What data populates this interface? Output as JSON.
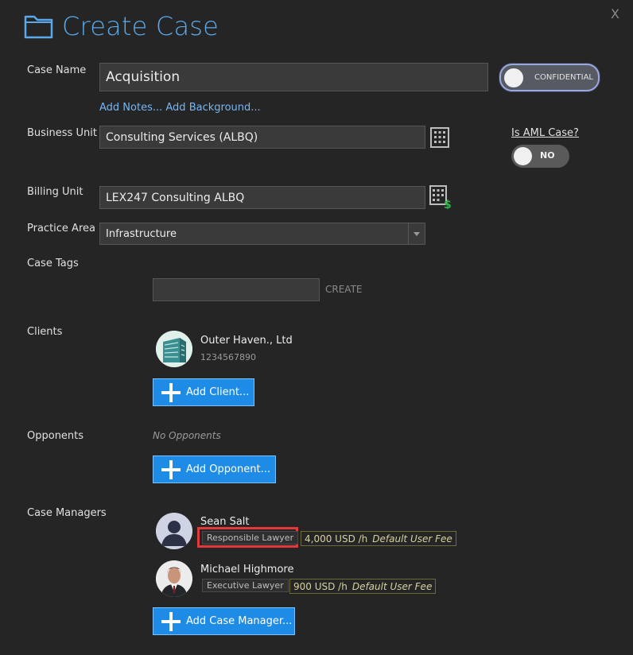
{
  "dialog": {
    "title": "Create Case",
    "close_label": "X"
  },
  "case_name": {
    "label": "Case Name",
    "value": "Acquisition"
  },
  "confidential_toggle": {
    "label": "CONFIDENTIAL"
  },
  "links": {
    "add_notes": "Add Notes...",
    "add_background": "Add Background..."
  },
  "business_unit": {
    "label": "Business Unit",
    "value": "Consulting Services (ALBQ)"
  },
  "aml": {
    "label": "Is AML Case?",
    "toggle_label": "NO"
  },
  "billing_unit": {
    "label": "Billing Unit",
    "value": "LEX247 Consulting ALBQ"
  },
  "practice_area": {
    "label": "Practice Area",
    "value": "Infrastructure"
  },
  "case_tags": {
    "label": "Case Tags",
    "input_value": "",
    "create_label": "CREATE"
  },
  "clients": {
    "label": "Clients",
    "items": [
      {
        "name": "Outer Haven., Ltd",
        "number": "1234567890"
      }
    ],
    "add_label": "Add Client..."
  },
  "opponents": {
    "label": "Opponents",
    "empty_text": "No Opponents",
    "add_label": "Add Opponent..."
  },
  "case_managers": {
    "label": "Case Managers",
    "items": [
      {
        "name": "Sean Salt",
        "role": "Responsible Lawyer",
        "fee": "4,000 USD /h",
        "fee_note": "Default User Fee"
      },
      {
        "name": "Michael Highmore",
        "role": "Executive Lawyer",
        "fee": "900 USD /h",
        "fee_note": "Default User Fee"
      }
    ],
    "add_label": "Add Case Manager..."
  },
  "colors": {
    "accent": "#5aa9ea",
    "button": "#1e8ce6",
    "highlight": "#e0393e",
    "background": "#252526"
  }
}
